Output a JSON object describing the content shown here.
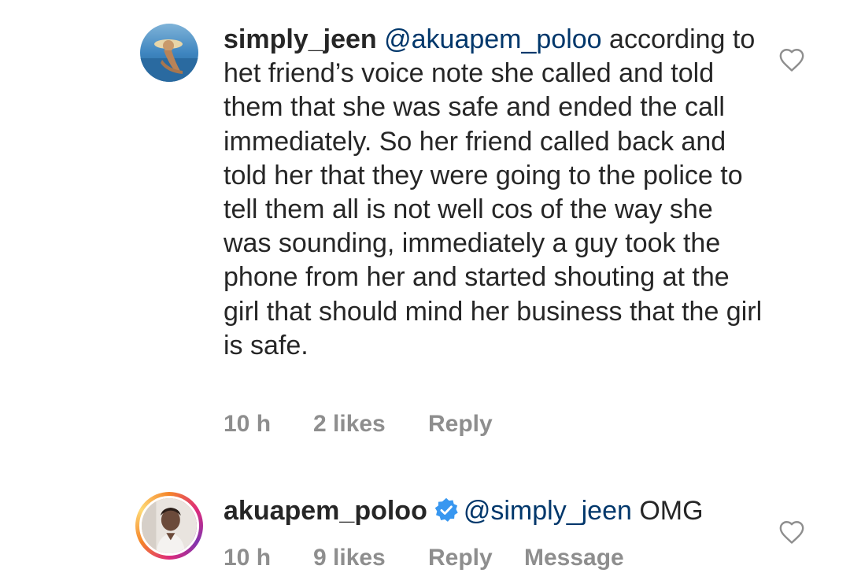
{
  "comments": [
    {
      "username": "simply_jeen",
      "mention": "@akuapem_poloo",
      "text": " according to het friend’s voice note she called and told them that she was safe and ended the call immediately. So her friend called back and told her that they were going to the police to tell them all is not well cos of the way she was sounding, immediately a guy took the phone from her and started shouting at the girl that should mind her business that the girl is safe.",
      "time": "10 h",
      "likes": "2 likes",
      "reply": "Reply",
      "verified": false
    },
    {
      "username": "akuapem_poloo",
      "mention": "@simply_jeen",
      "text": " OMG",
      "time": "10 h",
      "likes": "9 likes",
      "reply": "Reply",
      "message": "Message",
      "verified": true
    }
  ],
  "icons": {
    "like": "heart-outline-icon",
    "verified": "verified-badge-icon"
  },
  "colors": {
    "text": "#262626",
    "secondary": "#8e8e8e",
    "mention": "#00376b",
    "verified": "#3897f0"
  }
}
